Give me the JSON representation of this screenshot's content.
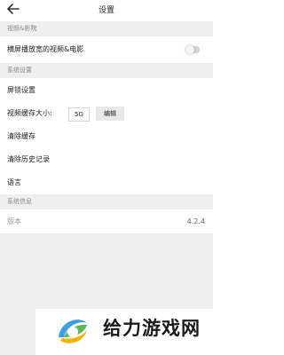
{
  "header": {
    "title": "设置",
    "back_icon": "arrow-left-icon"
  },
  "sections": {
    "video": {
      "header": "视频&影院",
      "landscape_label": "横屏播放宽的视频&电影",
      "landscape_toggle_on": false
    },
    "system_settings": {
      "header": "系统设置",
      "lock_screen": "屏锁设置",
      "video_cache_label": "视频缓存大小:",
      "video_cache_value": "5G",
      "edit_button": "编辑",
      "clear_cache": "清除缓存",
      "clear_history": "清除历史记录",
      "language": "语言"
    },
    "system_info": {
      "header": "系统信息",
      "version_label": "版本",
      "version_value": "4.2.4"
    }
  },
  "watermark": {
    "text": "给力游戏网"
  }
}
